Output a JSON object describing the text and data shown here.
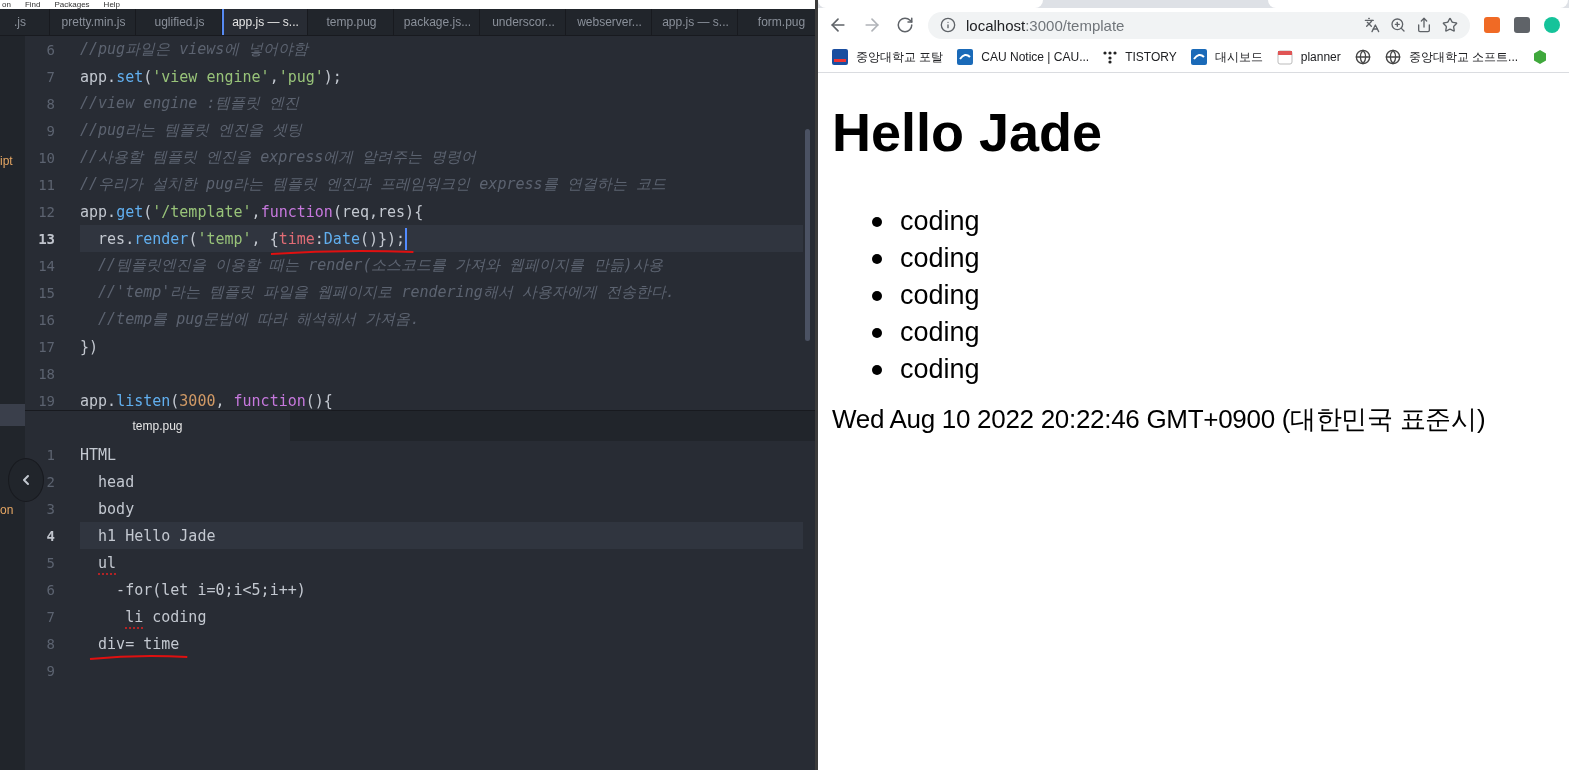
{
  "editor": {
    "menu": [
      "on",
      "Find",
      "Packages",
      "Help"
    ],
    "tree": [
      {
        "label": "ipt",
        "selected": false
      },
      {
        "label": "on",
        "selected": false
      }
    ],
    "tabs": [
      {
        "label": ".js",
        "selected": false
      },
      {
        "label": "pretty.min.js",
        "selected": false
      },
      {
        "label": "uglified.js",
        "selected": false
      },
      {
        "label": "app.js — s...",
        "selected": true
      },
      {
        "label": "temp.pug",
        "selected": false
      },
      {
        "label": "package.js...",
        "selected": false
      },
      {
        "label": "underscor...",
        "selected": false
      },
      {
        "label": "webserver...",
        "selected": false
      },
      {
        "label": "app.js — s...",
        "selected": false
      },
      {
        "label": "form.pug",
        "selected": false
      }
    ],
    "top_pane": {
      "lines": [
        {
          "n": "6",
          "current": false,
          "tokens": [
            {
              "text": "//pug파일은 views에 넣어야함",
              "kind": "comment"
            }
          ]
        },
        {
          "n": "7",
          "current": false,
          "tokens": [
            {
              "text": "app.",
              "kind": "plain"
            },
            {
              "text": "set",
              "kind": "method"
            },
            {
              "text": "(",
              "kind": "plain"
            },
            {
              "text": "'view engine'",
              "kind": "string"
            },
            {
              "text": ",",
              "kind": "plain"
            },
            {
              "text": "'pug'",
              "kind": "string"
            },
            {
              "text": ");",
              "kind": "plain"
            }
          ]
        },
        {
          "n": "8",
          "current": false,
          "tokens": [
            {
              "text": "//view engine :템플릿 엔진",
              "kind": "comment"
            }
          ]
        },
        {
          "n": "9",
          "current": false,
          "tokens": [
            {
              "text": "//pug라는 템플릿 엔진을 셋팅",
              "kind": "comment"
            }
          ]
        },
        {
          "n": "10",
          "current": false,
          "tokens": [
            {
              "text": "//사용할 템플릿 엔진을 express에게 알려주는 명령어",
              "kind": "comment"
            }
          ]
        },
        {
          "n": "11",
          "current": false,
          "tokens": [
            {
              "text": "//우리가 설치한 pug라는 템플릿 엔진과 프레임워크인 express를 연결하는 코드",
              "kind": "comment"
            }
          ]
        },
        {
          "n": "12",
          "current": false,
          "tokens": [
            {
              "text": "app.",
              "kind": "plain"
            },
            {
              "text": "get",
              "kind": "method"
            },
            {
              "text": "(",
              "kind": "plain"
            },
            {
              "text": "'/template'",
              "kind": "string"
            },
            {
              "text": ",",
              "kind": "plain"
            },
            {
              "text": "function",
              "kind": "keyword"
            },
            {
              "text": "(req,res){",
              "kind": "plain"
            }
          ]
        },
        {
          "n": "13",
          "current": true,
          "tokens": [
            {
              "text": "  res.",
              "kind": "plain"
            },
            {
              "text": "render",
              "kind": "method"
            },
            {
              "text": "(",
              "kind": "plain"
            },
            {
              "text": "'temp'",
              "kind": "string"
            },
            {
              "text": ", {",
              "kind": "plain"
            },
            {
              "text": "time",
              "kind": "property",
              "underlined": true
            },
            {
              "text": ":",
              "kind": "plain",
              "underlined": true
            },
            {
              "text": "Date",
              "kind": "method",
              "underlined": true
            },
            {
              "text": "()});",
              "kind": "plain",
              "underlined": true
            }
          ]
        },
        {
          "n": "14",
          "current": false,
          "tokens": [
            {
              "text": "  //템플릿엔진을 이용할 때는 render(소스코드를 가져와 웹페이지를 만듦)사용",
              "kind": "comment"
            }
          ]
        },
        {
          "n": "15",
          "current": false,
          "tokens": [
            {
              "text": "  //'temp'라는 템플릿 파일을 웹페이지로 rendering해서 사용자에게 전송한다.",
              "kind": "comment"
            }
          ]
        },
        {
          "n": "16",
          "current": false,
          "tokens": [
            {
              "text": "  //temp를 pug문법에 따라 해석해서 가져옴.",
              "kind": "comment"
            }
          ]
        },
        {
          "n": "17",
          "current": false,
          "tokens": [
            {
              "text": "})",
              "kind": "plain"
            }
          ]
        },
        {
          "n": "18",
          "current": false
        },
        {
          "n": "19",
          "current": false,
          "tokens": [
            {
              "text": "app.",
              "kind": "plain"
            },
            {
              "text": "listen",
              "kind": "method"
            },
            {
              "text": "(",
              "kind": "plain"
            },
            {
              "text": "3000",
              "kind": "number"
            },
            {
              "text": ", ",
              "kind": "plain"
            },
            {
              "text": "function",
              "kind": "keyword"
            },
            {
              "text": "(){",
              "kind": "plain"
            }
          ]
        }
      ]
    },
    "bottom_pane": {
      "tab": {
        "label": "temp.pug",
        "selected": true
      },
      "lines": [
        {
          "n": "1",
          "current": false,
          "tokens": [
            {
              "text": "HTML",
              "kind": "plain"
            }
          ]
        },
        {
          "n": "2",
          "current": false,
          "tokens": [
            {
              "text": "  head",
              "kind": "plain"
            }
          ]
        },
        {
          "n": "3",
          "current": false,
          "tokens": [
            {
              "text": "  body",
              "kind": "plain"
            }
          ]
        },
        {
          "n": "4",
          "current": true,
          "tokens": [
            {
              "text": "  h1 Hello Jade",
              "kind": "plain"
            }
          ]
        },
        {
          "n": "5",
          "current": false,
          "tokens": [
            {
              "text": "  ul",
              "kind": "misspelled"
            }
          ]
        },
        {
          "n": "6",
          "current": false,
          "tokens": [
            {
              "text": "    -for(let i=0;i<5;i++)",
              "kind": "plain"
            }
          ]
        },
        {
          "n": "7",
          "current": false,
          "tokens": [
            {
              "text": "     li",
              "kind": "misspelled"
            },
            {
              "text": " coding",
              "kind": "plain"
            }
          ]
        },
        {
          "n": "8",
          "current": false,
          "tokens": [
            {
              "text": "  div= time",
              "kind": "plain",
              "underlined": true
            }
          ]
        },
        {
          "n": "9",
          "current": false
        }
      ]
    }
  },
  "browser": {
    "address": {
      "host": "localhost",
      "path": ":3000/template"
    },
    "bookmarks": [
      {
        "label": "중앙대학교 포탈",
        "kind": "cau"
      },
      {
        "label": "CAU Notice | CAU...",
        "kind": "cau-script"
      },
      {
        "label": "TISTORY",
        "kind": "dots"
      },
      {
        "label": "대시보드",
        "kind": "cau-script"
      },
      {
        "label": "planner",
        "kind": "calendar"
      },
      {
        "kind": "globe"
      },
      {
        "label": "중앙대학교 소프트...",
        "kind": "globe"
      },
      {
        "kind": "hexagon"
      }
    ],
    "page": {
      "heading": "Hello Jade",
      "items": [
        "coding",
        "coding",
        "coding",
        "coding",
        "coding"
      ],
      "date": "Wed Aug 10 2022 20:22:46 GMT+0900 (대한민국 표준시)"
    }
  }
}
